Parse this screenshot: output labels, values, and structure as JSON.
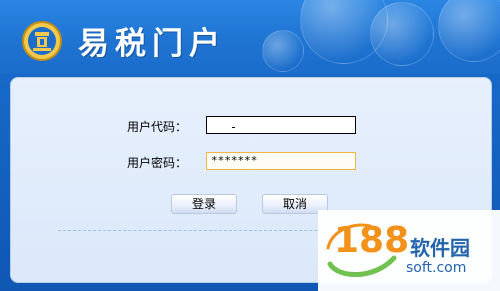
{
  "header": {
    "title": "易税门户",
    "emblem_icon": "tax-emblem-icon"
  },
  "form": {
    "username_label": "用户代码：",
    "username_value": "",
    "password_label": "用户密码：",
    "password_value": "*******"
  },
  "buttons": {
    "login_label": "登录",
    "cancel_label": "取消"
  },
  "watermark": {
    "number": "188",
    "name": "软件园",
    "domain": "soft.com"
  },
  "colors": {
    "header_blue": "#1f74d2",
    "panel_bg": "#e0ebfb",
    "password_border": "#f2b640",
    "watermark_orange": "#f48f12",
    "watermark_blue": "#1c5fa8"
  }
}
